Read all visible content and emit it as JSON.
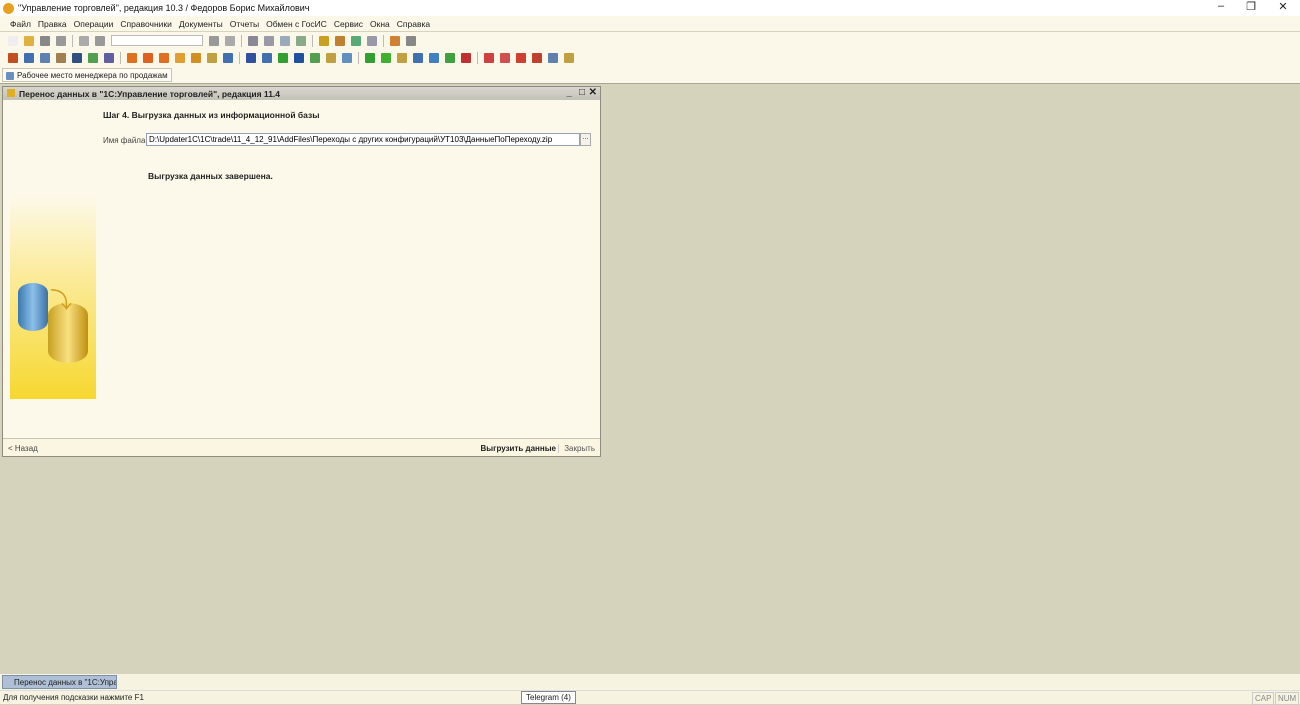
{
  "app": {
    "title": "\"Управление торговлей\", редакция 10.3 / Федоров Борис Михайлович",
    "logo": "1С"
  },
  "menu": [
    "Файл",
    "Правка",
    "Операции",
    "Справочники",
    "Документы",
    "Отчеты",
    "Обмен с ГосИС",
    "Сервис",
    "Окна",
    "Справка"
  ],
  "toolbar1_colors": [
    "#eee",
    "#e0b040",
    "#888",
    "#999",
    "#aaa",
    "#999",
    "#999",
    "#aaa",
    "#889",
    "#99a",
    "#9ab",
    "#8a8",
    "#c9a020",
    "#c08030",
    "#5a7",
    "#99a",
    "#d08030",
    "#888"
  ],
  "toolbar2_colors": [
    "#c05020",
    "#4070b0",
    "#6080b0",
    "#a08050",
    "#305080",
    "#50a050",
    "#6060a0",
    "#e07020",
    "#e06020",
    "#e07020",
    "#e0a030",
    "#d09020",
    "#c0a040",
    "#4070b0",
    "#3050a0",
    "#4070b0",
    "#30a030",
    "#2050a0",
    "#50a050",
    "#c0a040",
    "#6090c0",
    "#30a030",
    "#40b030",
    "#c0a040",
    "#4070b0",
    "#4080c0",
    "#40a040",
    "#c03030",
    "#d04040",
    "#d05050",
    "#d04030",
    "#c04030",
    "#6080b0",
    "#c0a040"
  ],
  "panel_tab": "Рабочее место менеджера по продажам",
  "dialog": {
    "title": "Перенос данных в \"1С:Управление торговлей\", редакция 11.4",
    "step": "Шаг 4. Выгрузка данных из информационной базы",
    "file_label": "Имя файла:",
    "file_value": "D:\\Updater1C\\1C\\trade\\11_4_12_91\\AddFiles\\Переходы с других конфигураций\\УТ103\\ДанныеПоПереходу.zip",
    "browse": "...",
    "done": "Выгрузка данных завершена.",
    "back": "< Назад",
    "export": "Выгрузить данные",
    "close": "Закрыть"
  },
  "taskbar": {
    "item": "Перенос данных в \"1С:Упра..."
  },
  "status": {
    "hint": "Для получения подсказки нажмите F1",
    "tooltip": "Telegram (4)",
    "cap": "CAP",
    "num": "NUM"
  }
}
